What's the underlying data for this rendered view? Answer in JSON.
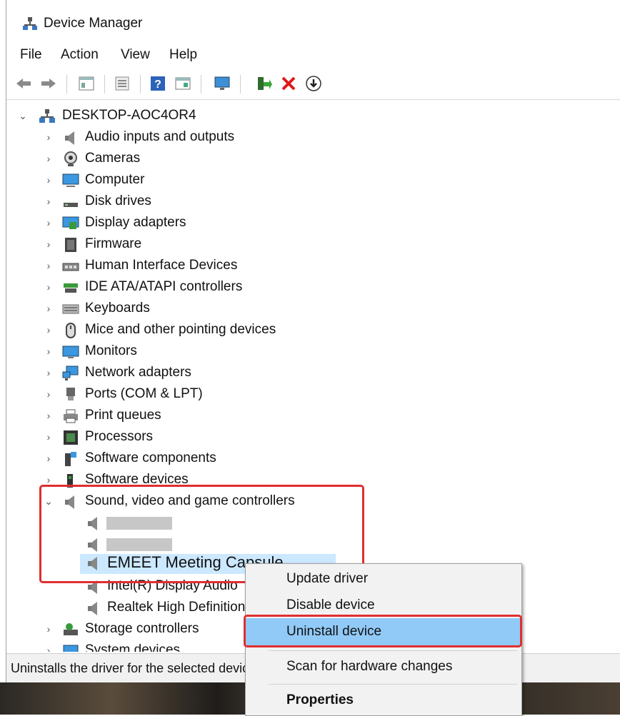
{
  "window": {
    "title": "Device Manager"
  },
  "menu": [
    "File",
    "Action",
    "View",
    "Help"
  ],
  "toolbar": [
    "back-arrow-icon",
    "forward-arrow-icon",
    "properties-icon",
    "list-icon",
    "help-icon",
    "details-icon",
    "monitor-icon",
    "add-driver-icon",
    "uninstall-x-icon",
    "download-icon"
  ],
  "tree": {
    "root": "DESKTOP-AOC4OR4",
    "categories": [
      "Audio inputs and outputs",
      "Cameras",
      "Computer",
      "Disk drives",
      "Display adapters",
      "Firmware",
      "Human Interface Devices",
      "IDE ATA/ATAPI controllers",
      "Keyboards",
      "Mice and other pointing devices",
      "Monitors",
      "Network adapters",
      "Ports (COM & LPT)",
      "Print queues",
      "Processors",
      "Software components",
      "Software devices",
      "Sound, video and game controllers",
      "Storage controllers",
      "System devices"
    ],
    "sound_children": [
      "",
      "",
      "EMEET Meeting Capsule",
      "Intel(R) Display Audio",
      "Realtek High Definition Audio"
    ]
  },
  "context_menu": {
    "items": [
      "Update driver",
      "Disable device",
      "Uninstall device",
      "Scan for hardware changes",
      "Properties"
    ],
    "highlighted": "Uninstall device"
  },
  "status": "Uninstalls the driver for the selected device.",
  "colors": {
    "annotation": "#e02e2e",
    "selection": "#cce8ff",
    "menu_highlight": "#91c9f7"
  }
}
